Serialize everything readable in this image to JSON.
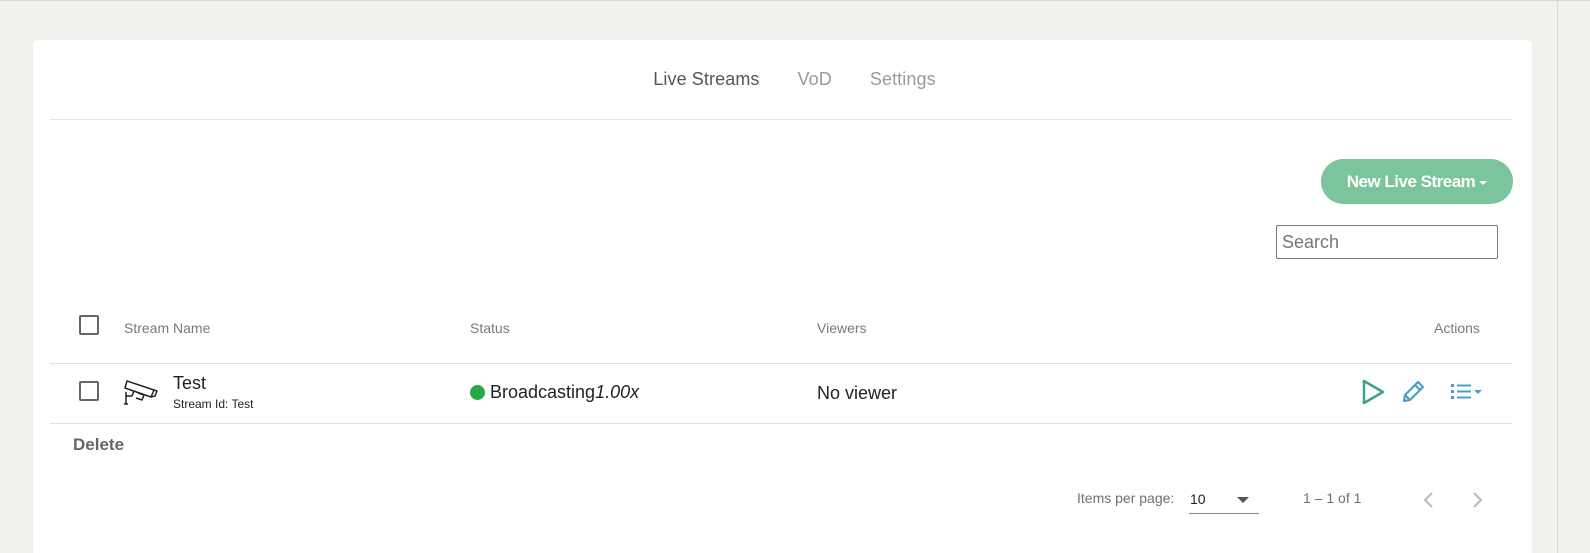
{
  "tabs": [
    {
      "label": "Live Streams",
      "active": true
    },
    {
      "label": "VoD",
      "active": false
    },
    {
      "label": "Settings",
      "active": false
    }
  ],
  "toolbar": {
    "new_stream_label": "New Live Stream",
    "search_placeholder": "Search"
  },
  "table": {
    "headers": {
      "name": "Stream Name",
      "status": "Status",
      "viewers": "Viewers",
      "actions": "Actions"
    },
    "rows": [
      {
        "name": "Test",
        "stream_id_label": "Stream Id: Test",
        "status": "Broadcasting",
        "speed": "1.00x",
        "viewers": "No viewer",
        "status_color": "#28a745"
      }
    ]
  },
  "bulk": {
    "delete_label": "Delete"
  },
  "pagination": {
    "items_per_page_label": "Items per page:",
    "page_size": "10",
    "range_label": "1 – 1 of 1"
  },
  "colors": {
    "accent": "#7cc49b",
    "action_play": "#3aa57a",
    "action_edit": "#4a9fc8"
  },
  "icons": {
    "row_icon": "security-camera-icon",
    "play": "play-icon",
    "edit": "pencil-icon",
    "menu": "list-menu-icon"
  }
}
